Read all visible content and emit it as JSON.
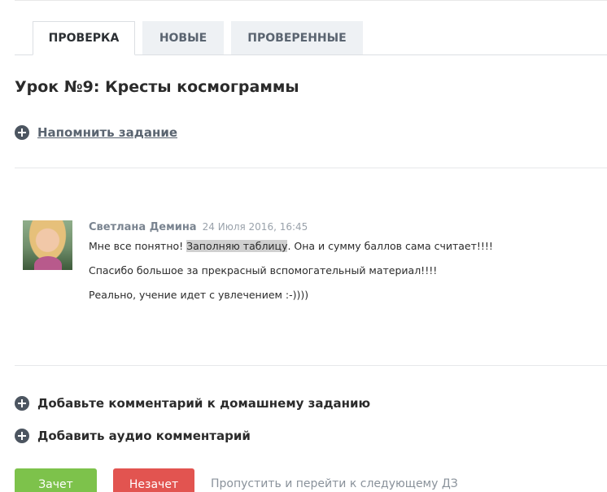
{
  "tabs": [
    {
      "label": "ПРОВЕРКА",
      "active": true
    },
    {
      "label": "НОВЫЕ",
      "active": false
    },
    {
      "label": "ПРОВЕРЕННЫЕ",
      "active": false
    }
  ],
  "lesson": {
    "title": "Урок №9: Кресты космограммы",
    "remind_label": "Напомнить задание"
  },
  "comment": {
    "author": "Светлана Демина",
    "date": "24 Июля 2016, 16:45",
    "line1_before": "Мне все понятно! ",
    "line1_highlight": "Заполняю таблицу",
    "line1_after": ". Она и сумму баллов сама считает!!!!",
    "line2": "Спасибо большое за прекрасный вспомогательный материал!!!!",
    "line3": "Реально, учение идет с увлечением  :-))))"
  },
  "actions": {
    "add_comment": "Добавьте комментарий к домашнему заданию",
    "add_audio": "Добавить аудио комментарий"
  },
  "buttons": {
    "pass": "Зачет",
    "fail": "Незачет",
    "skip": "Пропустить и перейти к следующему ДЗ"
  },
  "colors": {
    "pass": "#7dc24b",
    "fail": "#e25450",
    "tab_inactive_bg": "#eef1f4"
  }
}
